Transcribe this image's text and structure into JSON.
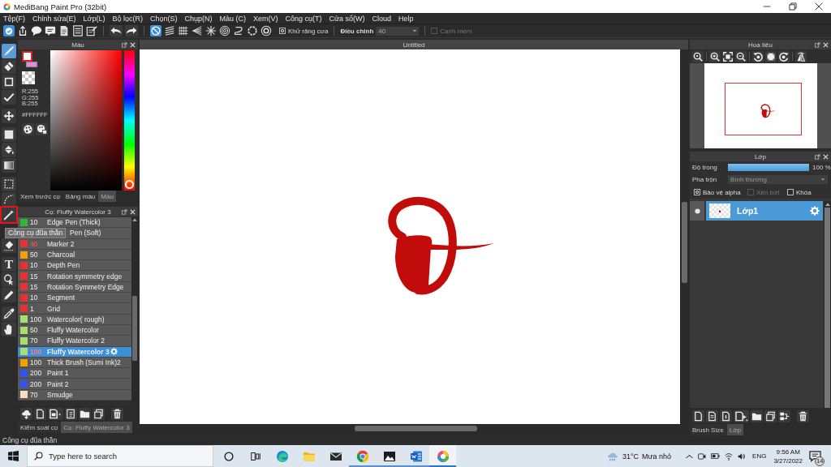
{
  "window": {
    "title": "MediBang Paint Pro (32bit)"
  },
  "menu": [
    "Tệp(F)",
    "Chỉnh sửa(E)",
    "Lớp(L)",
    "Bộ lọc(R)",
    "Chọn(S)",
    "Chụp(N)",
    "Màu (C)",
    "Xem(V)",
    "Công cụ(T)",
    "Cửa sổ(W)",
    "Cloud",
    "Help"
  ],
  "toolbar": {
    "snap_modes": [
      {
        "kind": "off",
        "selected": true
      },
      {
        "kind": "parallel",
        "selected": false
      },
      {
        "kind": "grid",
        "selected": false
      },
      {
        "kind": "perspective",
        "selected": false
      },
      {
        "kind": "radial",
        "selected": false
      },
      {
        "kind": "concentric",
        "selected": false
      },
      {
        "kind": "curve",
        "selected": false
      },
      {
        "kind": "circle",
        "selected": false
      },
      {
        "kind": "settings",
        "selected": false
      }
    ],
    "antialias": {
      "label": "Khử răng cưa",
      "checked": true
    },
    "adjust": {
      "label": "Điều chỉnh",
      "value": "40"
    },
    "soft_edge": {
      "label": "Cạnh mềm",
      "checked": false,
      "disabled": true
    }
  },
  "tools": [
    [
      {
        "kind": "brush",
        "selected": true,
        "highlighted": false
      },
      {
        "kind": "eraser",
        "selected": false,
        "highlighted": false
      },
      {
        "kind": "dot",
        "selected": false,
        "highlighted": false
      },
      {
        "kind": "pen",
        "selected": false,
        "highlighted": false
      }
    ],
    [
      {
        "kind": "move",
        "selected": false,
        "highlighted": false
      }
    ],
    [
      {
        "kind": "fill",
        "selected": false,
        "highlighted": false
      },
      {
        "kind": "bucket",
        "selected": false,
        "highlighted": false
      },
      {
        "kind": "gradient",
        "selected": false,
        "highlighted": false
      }
    ],
    [
      {
        "kind": "select",
        "selected": false,
        "highlighted": false
      },
      {
        "kind": "lasso",
        "selected": false,
        "highlighted": false
      },
      {
        "kind": "wand",
        "selected": false,
        "highlighted": true
      },
      {
        "kind": "gap"
      },
      {
        "kind": "unselect",
        "selected": false,
        "highlighted": false
      }
    ],
    [
      {
        "kind": "text",
        "label": "T",
        "selected": false,
        "highlighted": false
      },
      {
        "kind": "operation",
        "selected": false,
        "highlighted": false
      },
      {
        "kind": "divide",
        "selected": false,
        "highlighted": false
      }
    ],
    [
      {
        "kind": "eyedropper",
        "selected": false,
        "highlighted": false
      },
      {
        "kind": "hand",
        "selected": false,
        "highlighted": false
      }
    ]
  ],
  "tooltip": "Công cụ đũa thần",
  "color_panel": {
    "title": "Màu",
    "swatches": [
      {
        "color": "#ffffff",
        "selected": true
      },
      {
        "color": "#e38ae6",
        "selected": false
      }
    ],
    "rgb": [
      "R:255",
      "G:255",
      "B:255"
    ],
    "hex": "#FFFFFF",
    "hue": {
      "level": 0
    },
    "tabs": [
      {
        "label": "Xem trước cọ",
        "selected": false
      },
      {
        "label": "Bảng màu",
        "selected": false
      },
      {
        "label": "Màu",
        "selected": true
      }
    ]
  },
  "brush_panel": {
    "title": "Cọ: Fluffy Watercolor 3",
    "rows": [
      {
        "kind": "full",
        "color": "#2fb82f",
        "size": "10",
        "size_marked": false,
        "name": "Edge Pen (Thick)",
        "selected": false
      },
      {
        "kind": "partial",
        "name": "Pen (Soft)",
        "selected": false
      },
      {
        "kind": "full",
        "color": "#e83232",
        "size": "40",
        "size_marked": true,
        "name": "Marker 2",
        "selected": false
      },
      {
        "kind": "full",
        "color": "#f0a000",
        "size": "50",
        "size_marked": false,
        "name": "Charcoal",
        "selected": false
      },
      {
        "kind": "full",
        "color": "#e83232",
        "size": "10",
        "size_marked": false,
        "name": "Depth Pen",
        "selected": false
      },
      {
        "kind": "full",
        "color": "#e83232",
        "size": "15",
        "size_marked": false,
        "name": "Rotation symmetry edge",
        "selected": false
      },
      {
        "kind": "full",
        "color": "#e83232",
        "size": "15",
        "size_marked": false,
        "name": "Rotation Symmetry Edge",
        "selected": false
      },
      {
        "kind": "full",
        "color": "#e83232",
        "size": "10",
        "size_marked": false,
        "name": "Segment",
        "selected": false
      },
      {
        "kind": "full",
        "color": "#e83232",
        "size": "1",
        "size_marked": false,
        "name": "Grid",
        "selected": false
      },
      {
        "kind": "full",
        "color": "#a8e070",
        "size": "100",
        "size_marked": false,
        "name": "Watercolor( rough)",
        "selected": false
      },
      {
        "kind": "full",
        "color": "#a8e070",
        "size": "50",
        "size_marked": false,
        "name": "Fluffy Watercolor",
        "selected": false
      },
      {
        "kind": "full",
        "color": "#a8e070",
        "size": "70",
        "size_marked": false,
        "name": "Fluffy Watercolor 2",
        "selected": false
      },
      {
        "kind": "full",
        "color": "#a8e070",
        "size": "100",
        "size_marked": true,
        "name": "Fluffy Watercolor 3",
        "selected": true
      },
      {
        "kind": "full",
        "color": "#f0a000",
        "size": "100",
        "size_marked": false,
        "name": "Thick Brush (Sumi Ink)2",
        "selected": false
      },
      {
        "kind": "full",
        "color": "#2f55f0",
        "size": "200",
        "size_marked": false,
        "name": "Paint 1",
        "selected": false
      },
      {
        "kind": "full",
        "color": "#2f55f0",
        "size": "200",
        "size_marked": false,
        "name": "Paint 2",
        "selected": false
      },
      {
        "kind": "full",
        "color": "#f8dcc0",
        "size": "70",
        "size_marked": false,
        "name": "Smudge",
        "selected": false
      }
    ],
    "tabs": [
      {
        "label": "Kiểm soát cọ",
        "selected": false
      },
      {
        "label": "Cọ: Fluffy Watercolor 3",
        "selected": true
      }
    ]
  },
  "canvas": {
    "title": "Untitled"
  },
  "navigator": {
    "title": "Hoa tiêu"
  },
  "layer_panel": {
    "title": "Lớp",
    "opacity": {
      "label": "Độ trong",
      "level": 1,
      "reading": "100 %"
    },
    "blend": {
      "label": "Pha trộn",
      "value": "Bình thường"
    },
    "options": [
      {
        "label": "Bảo vệ alpha",
        "checked": true,
        "disabled": false
      },
      {
        "label": "Xén bớt",
        "checked": false,
        "disabled": true
      },
      {
        "label": "Khóa",
        "checked": false,
        "disabled": false
      }
    ],
    "layers": [
      {
        "name": "Lớp1",
        "visible": true,
        "selected": true
      }
    ],
    "tabs": [
      {
        "label": "Brush Size",
        "selected": false
      },
      {
        "label": "Lớp",
        "selected": true
      }
    ]
  },
  "status_bar": "Công cụ đũa thần",
  "taskbar": {
    "search": {
      "placeholder": "Type here to search"
    },
    "apps": [
      {
        "kind": "swirl",
        "running": false,
        "selected": false
      },
      {
        "kind": "folder",
        "running": false,
        "selected": false
      },
      {
        "kind": "envelope",
        "running": false,
        "selected": false
      },
      {
        "kind": "sectors",
        "running": true,
        "selected": false
      },
      {
        "kind": "picture",
        "running": true,
        "selected": false
      },
      {
        "kind": "document",
        "running": true,
        "selected": false
      },
      {
        "kind": "pinwheel",
        "running": true,
        "selected": true
      }
    ],
    "weather": {
      "temperature": "31°C",
      "condition": "Mưa nhỏ"
    },
    "language": "ENG",
    "time": "9:56 AM",
    "date": "3/27/2022",
    "notification_count": "14"
  }
}
